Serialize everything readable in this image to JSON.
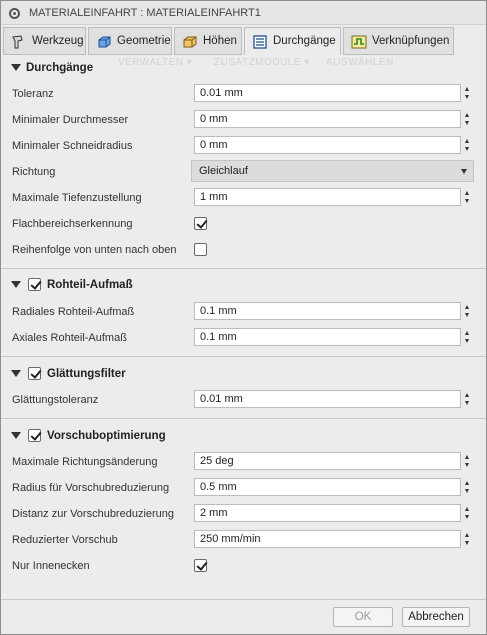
{
  "window": {
    "title": "MATERIALEINFAHRT : MATERIALEINFAHRT1"
  },
  "tabs": [
    {
      "label": "Werkzeug",
      "icon": "tool-icon"
    },
    {
      "label": "Geometrie",
      "icon": "geometry-icon"
    },
    {
      "label": "Höhen",
      "icon": "heights-icon"
    },
    {
      "label": "Durchgänge",
      "icon": "passes-icon",
      "active": true
    },
    {
      "label": "Verknüpfungen",
      "icon": "linking-icon"
    }
  ],
  "background_menu": {
    "items": [
      "VERWALTEN ▾",
      "ZUSATZMODULE ▾",
      "AUSWÄHLEN"
    ]
  },
  "sections": {
    "durchgaenge": {
      "title": "Durchgänge",
      "toleranz": {
        "label": "Toleranz",
        "value": "0.01 mm"
      },
      "min_durchmesser": {
        "label": "Minimaler Durchmesser",
        "value": "0 mm"
      },
      "min_schneidradius": {
        "label": "Minimaler Schneidradius",
        "value": "0 mm"
      },
      "richtung": {
        "label": "Richtung",
        "value": "Gleichlauf"
      },
      "max_tiefenzustellung": {
        "label": "Maximale Tiefenzustellung",
        "value": "1 mm"
      },
      "flachbereich": {
        "label": "Flachbereichserkennung",
        "checked": true
      },
      "reihenfolge": {
        "label": "Reihenfolge von unten nach oben",
        "checked": false
      }
    },
    "rohteil": {
      "title": "Rohteil-Aufmaß",
      "checked": true,
      "radial": {
        "label": "Radiales Rohteil-Aufmaß",
        "value": "0.1 mm"
      },
      "axial": {
        "label": "Axiales Rohteil-Aufmaß",
        "value": "0.1 mm"
      }
    },
    "glaettung": {
      "title": "Glättungsfilter",
      "checked": true,
      "toleranz": {
        "label": "Glättungstoleranz",
        "value": "0.01 mm"
      }
    },
    "vorschub": {
      "title": "Vorschuboptimierung",
      "checked": true,
      "max_richtung": {
        "label": "Maximale Richtungsänderung",
        "value": "25 deg"
      },
      "radius": {
        "label": "Radius für Vorschubreduzierung",
        "value": "0.5 mm"
      },
      "distanz": {
        "label": "Distanz zur Vorschubreduzierung",
        "value": "2 mm"
      },
      "reduziert": {
        "label": "Reduzierter Vorschub",
        "value": "250 mm/min"
      },
      "innenecken": {
        "label": "Nur Innenecken",
        "checked": true
      }
    }
  },
  "buttons": {
    "ok": "OK",
    "cancel": "Abbrechen"
  },
  "colors": {
    "dialog_bg": "#ececec",
    "field_bg": "#ffffff",
    "select_bg": "#dcdcdc",
    "disabled_text": "#9a9a9a"
  }
}
